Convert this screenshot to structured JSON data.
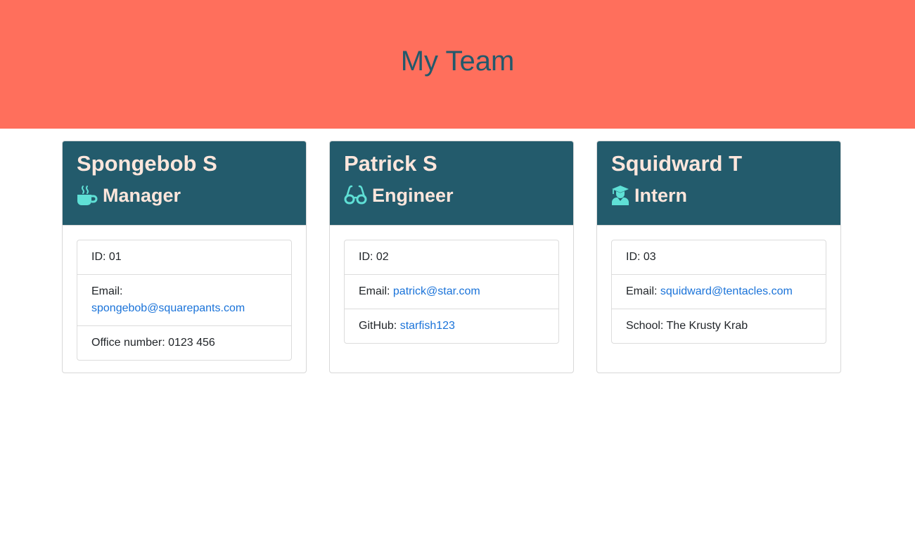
{
  "header": {
    "title": "My Team"
  },
  "colors": {
    "jumbotron_bg": "#ff6f5c",
    "title_color": "#23596b",
    "card_header_bg": "#235b6c",
    "card_header_text": "#fde6dc",
    "icon_color": "#5fe0d6",
    "link_color": "#1a73d9"
  },
  "employees": [
    {
      "name": "Spongebob S",
      "role": "Manager",
      "icon": "coffee-mug-icon",
      "id_label": "ID: ",
      "id": "01",
      "email_label": "Email: ",
      "email": "spongebob@squarepants.com",
      "extra_label": "Office number: ",
      "extra_value": "0123 456"
    },
    {
      "name": "Patrick S",
      "role": "Engineer",
      "icon": "glasses-icon",
      "id_label": "ID: ",
      "id": "02",
      "email_label": "Email: ",
      "email": "patrick@star.com",
      "extra_label": "GitHub: ",
      "extra_value": "starfish123"
    },
    {
      "name": "Squidward T",
      "role": "Intern",
      "icon": "graduate-icon",
      "id_label": "ID: ",
      "id": "03",
      "email_label": "Email: ",
      "email": "squidward@tentacles.com",
      "extra_label": "School: ",
      "extra_value": "The Krusty Krab"
    }
  ]
}
